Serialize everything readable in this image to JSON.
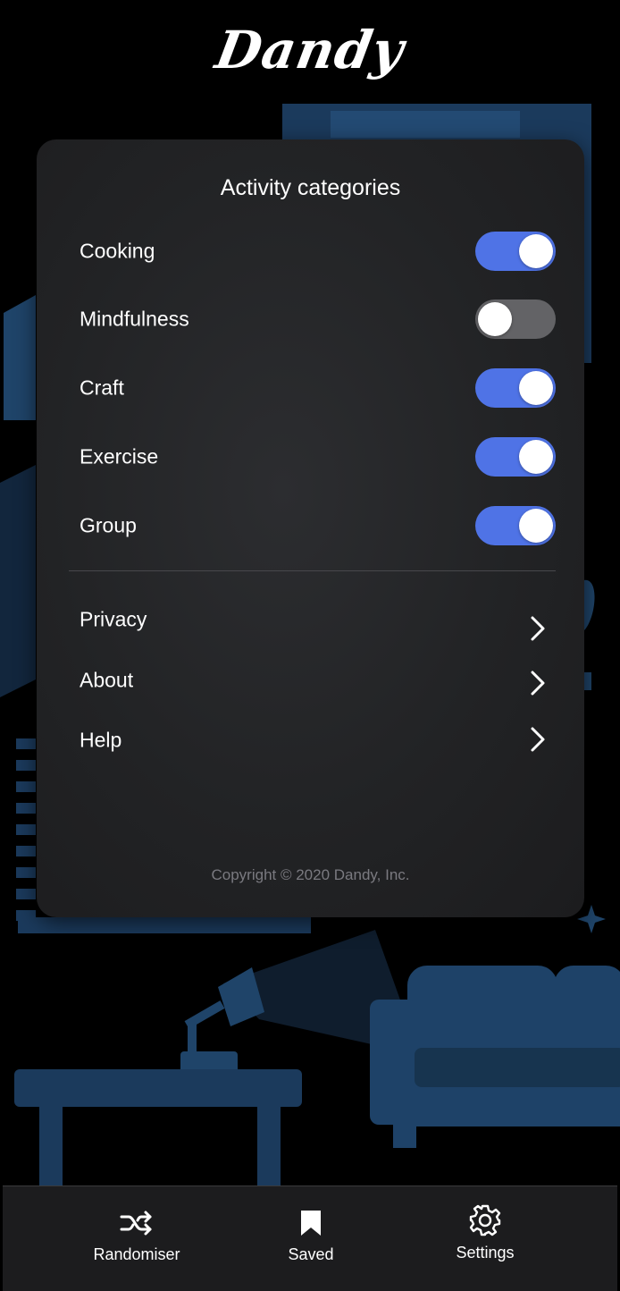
{
  "app": {
    "logo": "Dandy"
  },
  "settings": {
    "title": "Activity categories",
    "categories": [
      {
        "label": "Cooking",
        "enabled": true
      },
      {
        "label": "Mindfulness",
        "enabled": false
      },
      {
        "label": "Craft",
        "enabled": true
      },
      {
        "label": "Exercise",
        "enabled": true
      },
      {
        "label": "Group",
        "enabled": true
      }
    ],
    "links": [
      {
        "label": "Privacy",
        "icon": "chevron-right-icon"
      },
      {
        "label": "About",
        "icon": "chevron-right-icon"
      },
      {
        "label": "Help",
        "icon": "chevron-right-icon"
      }
    ],
    "copyright": "Copyright © 2020 Dandy, Inc."
  },
  "tabbar": {
    "tabs": [
      {
        "label": "Randomiser",
        "icon": "shuffle-icon"
      },
      {
        "label": "Saved",
        "icon": "bookmark-icon"
      },
      {
        "label": "Settings",
        "icon": "gear-icon",
        "active": true
      }
    ]
  },
  "colors": {
    "toggle_on": "#4f73e6",
    "toggle_off": "#636366",
    "panel": "#222325",
    "illustration": "#1b3a5c"
  }
}
